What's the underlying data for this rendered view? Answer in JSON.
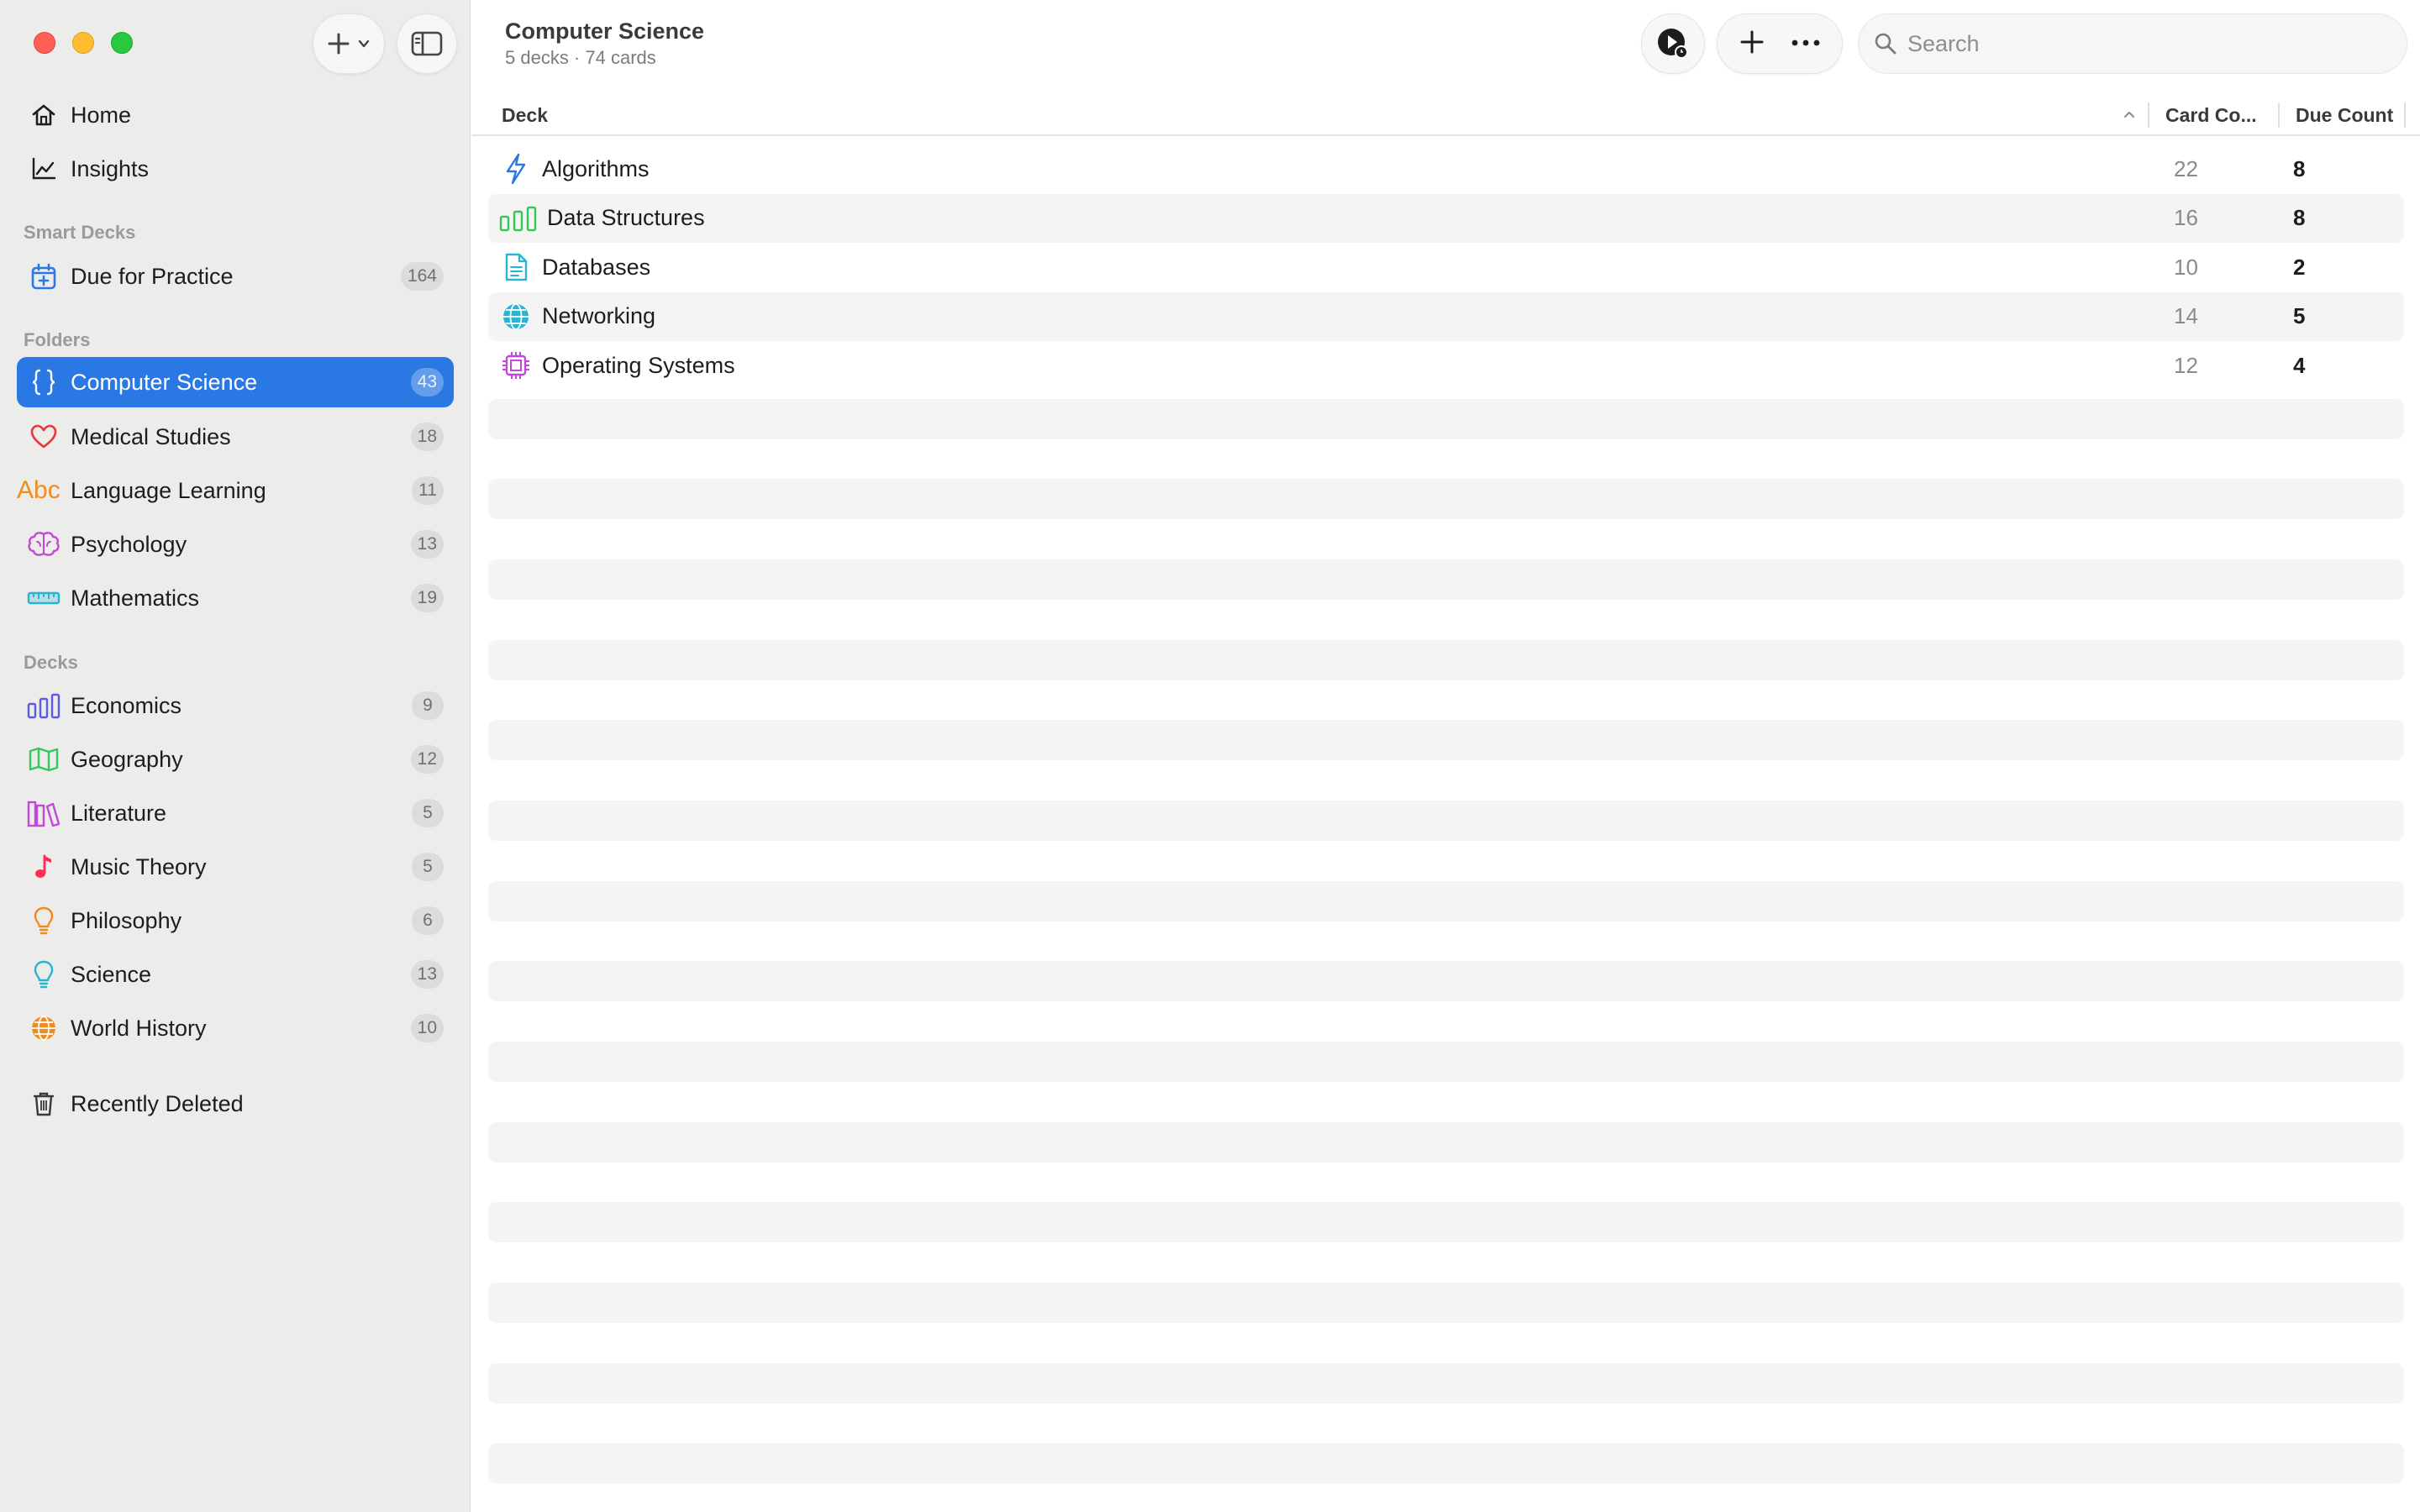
{
  "sidebar": {
    "home_label": "Home",
    "insights_label": "Insights",
    "smart_decks_header": "Smart Decks",
    "due_label": "Due for Practice",
    "due_count": "164",
    "folders_header": "Folders",
    "folders": [
      {
        "label": "Computer Science",
        "count": "43",
        "icon": "braces-icon",
        "color": "#2a78e4"
      },
      {
        "label": "Medical Studies",
        "count": "18",
        "icon": "heart-icon",
        "color": "#e5383b"
      },
      {
        "label": "Language Learning",
        "count": "11",
        "icon": "abc-icon",
        "color": "#f08c1e"
      },
      {
        "label": "Psychology",
        "count": "13",
        "icon": "brain-icon",
        "color": "#c248d8"
      },
      {
        "label": "Mathematics",
        "count": "19",
        "icon": "ruler-icon",
        "color": "#26b5d3"
      }
    ],
    "decks_header": "Decks",
    "decks": [
      {
        "label": "Economics",
        "count": "9",
        "icon": "bar-chart-icon",
        "color": "#5b5ce6"
      },
      {
        "label": "Geography",
        "count": "12",
        "icon": "map-icon",
        "color": "#34c759"
      },
      {
        "label": "Literature",
        "count": "5",
        "icon": "books-icon",
        "color": "#c248d8"
      },
      {
        "label": "Music Theory",
        "count": "5",
        "icon": "music-note-icon",
        "color": "#ff2d55"
      },
      {
        "label": "Philosophy",
        "count": "6",
        "icon": "lightbulb-icon",
        "color": "#f08c1e"
      },
      {
        "label": "Science",
        "count": "13",
        "icon": "lightbulb-icon",
        "color": "#26b5d3"
      },
      {
        "label": "World History",
        "count": "10",
        "icon": "globe-icon",
        "color": "#f08c1e"
      }
    ],
    "recently_deleted_label": "Recently Deleted"
  },
  "main": {
    "title": "Computer Science",
    "subtitle": "5 decks · 74 cards",
    "search_placeholder": "Search",
    "columns": {
      "deck": "Deck",
      "card_count": "Card Co...",
      "due_count": "Due Count"
    },
    "rows": [
      {
        "name": "Algorithms",
        "card_count": "22",
        "due_count": "8",
        "icon": "bolt-icon",
        "color": "#2a78e4"
      },
      {
        "name": "Data Structures",
        "card_count": "16",
        "due_count": "8",
        "icon": "bar-chart-icon",
        "color": "#34c759"
      },
      {
        "name": "Databases",
        "card_count": "10",
        "due_count": "2",
        "icon": "document-icon",
        "color": "#26b5d3"
      },
      {
        "name": "Networking",
        "card_count": "14",
        "due_count": "5",
        "icon": "globe-icon",
        "color": "#26b5d3"
      },
      {
        "name": "Operating Systems",
        "card_count": "12",
        "due_count": "4",
        "icon": "cpu-icon",
        "color": "#c248d8"
      }
    ]
  }
}
